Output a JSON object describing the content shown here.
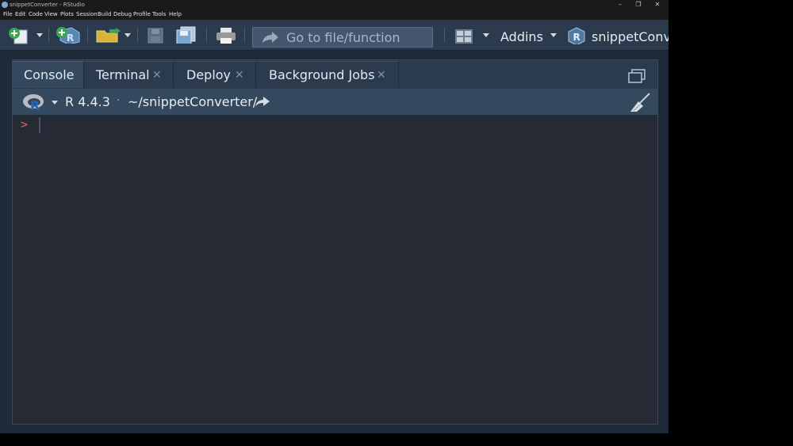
{
  "window": {
    "title": "snippetConverter - RStudio",
    "controls": [
      "–",
      "❐",
      "✕"
    ]
  },
  "menu": [
    "File",
    "Edit",
    "Code",
    "View",
    "Plots",
    "Session",
    "Build",
    "Debug",
    "Profile",
    "Tools",
    "Help"
  ],
  "toolbar": {
    "goto_placeholder": "Go to file/function",
    "addins_label": "Addins",
    "project_label": "snippetConverter"
  },
  "tabs": [
    {
      "label": "Console",
      "active": true,
      "closable": false
    },
    {
      "label": "Terminal",
      "active": false,
      "closable": true
    },
    {
      "label": "Deploy",
      "active": false,
      "closable": true
    },
    {
      "label": "Background Jobs",
      "active": false,
      "closable": true
    }
  ],
  "console": {
    "r_version": "R 4.4.3",
    "separator": "·",
    "working_dir": "~/snippetConverter/",
    "prompt": ">"
  },
  "colors": {
    "accent_r": "#75aadb",
    "prompt": "#e0625f",
    "toolbar_bg": "#2b3a4c",
    "console_bg": "#252a34"
  }
}
